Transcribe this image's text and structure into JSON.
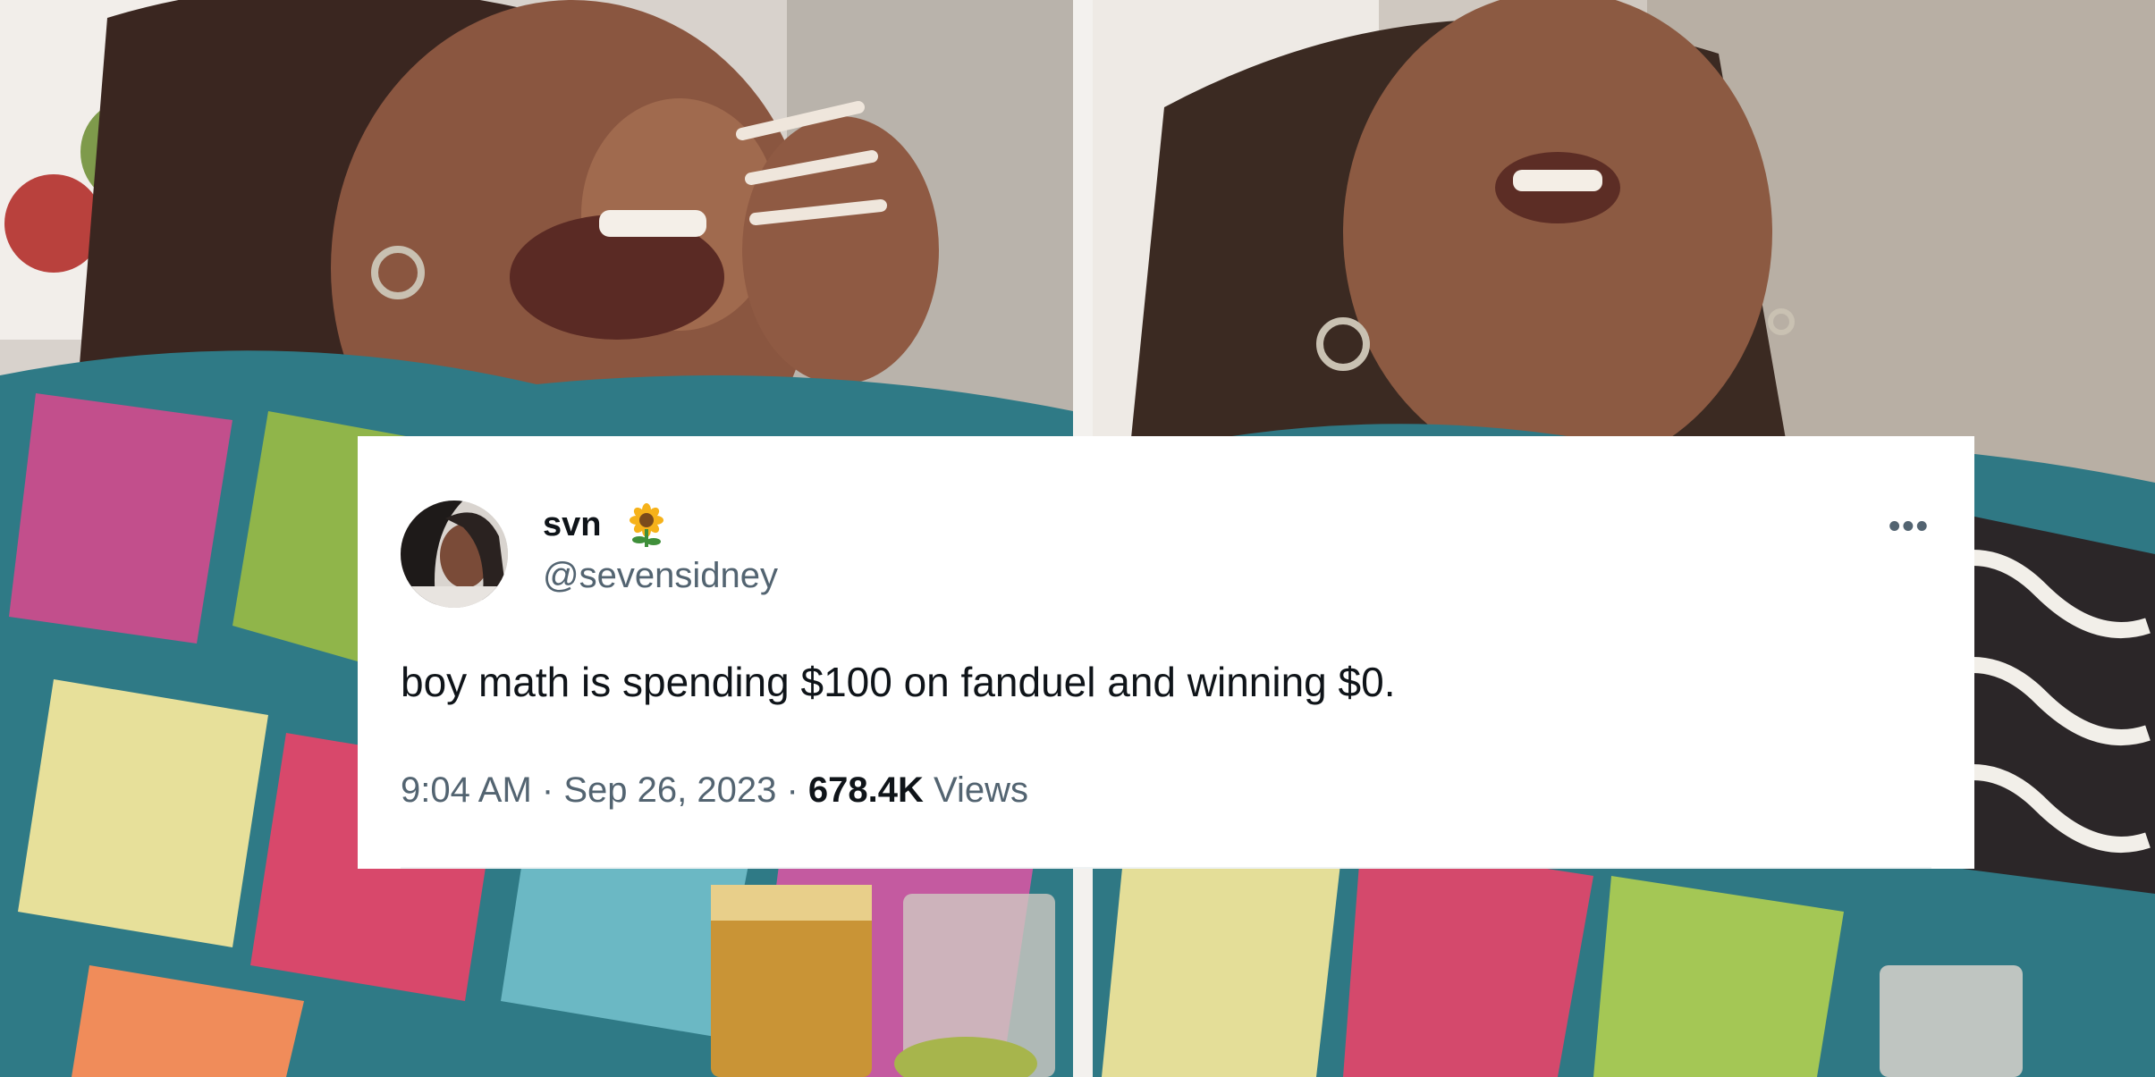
{
  "tweet": {
    "display_name": "svn",
    "display_name_emoji": "sunflower-icon",
    "handle": "@sevensidney",
    "text": "boy math is spending $100 on fanduel and winning $0.",
    "time": "9:04 AM",
    "separator": "·",
    "date": "Sep 26, 2023",
    "views_count": "678.4K",
    "views_label": "Views",
    "more_icon": "more-icon"
  },
  "colors": {
    "name_text": "#0f1419",
    "secondary_text": "#536471",
    "card_background": "#ffffff"
  }
}
